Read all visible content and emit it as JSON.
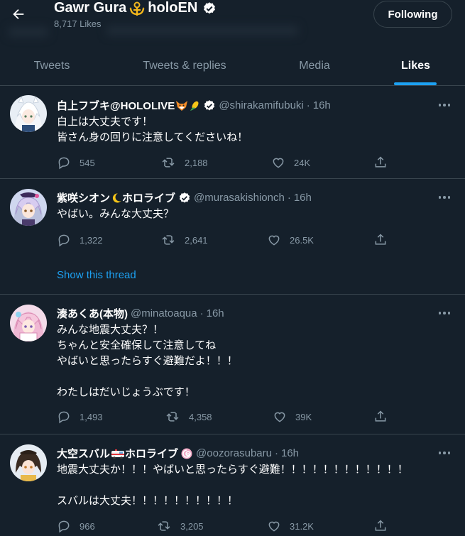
{
  "header": {
    "title": "Gawr Gura",
    "title_suffix": "holoEN",
    "likes_count": "8,717 Likes",
    "follow_label": "Following"
  },
  "tabs": [
    {
      "label": "Tweets",
      "active": false
    },
    {
      "label": "Tweets & replies",
      "active": false
    },
    {
      "label": "Media",
      "active": false
    },
    {
      "label": "Likes",
      "active": true
    }
  ],
  "tweets": [
    {
      "name": "白上フブキ@HOLOLIVE",
      "handle": "@shirakamifubuki",
      "time": "16h",
      "text": "白上は大丈夫です！\n皆さん身の回りに注意してくださいね！",
      "replies": "545",
      "retweets": "2,188",
      "likes": "24K"
    },
    {
      "name": "紫咲シオン",
      "name_suffix": "ホロライブ",
      "handle": "@murasakishionch",
      "time": "16h",
      "text": "やばい。みんな大丈夫？",
      "replies": "1,322",
      "retweets": "2,641",
      "likes": "26.5K",
      "thread_link": "Show this thread"
    },
    {
      "name": "湊あくあ(本物)",
      "handle": "@minatoaqua",
      "time": "16h",
      "text": "みんな地震大丈夫？！\nちゃんと安全確保して注意してね\nやばいと思ったらすぐ避難だよ！！！\n\nわたしはだいじょうぶです！",
      "replies": "1,493",
      "retweets": "4,358",
      "likes": "39K"
    },
    {
      "name": "大空スバル",
      "name_suffix": "ホロライブ",
      "handle": "@oozorasubaru",
      "time": "16h",
      "text": "地震大丈夫か！！！やばいと思ったらすぐ避難！！！！！！！！！！！！\n\nスバルは大丈夫！！！！！！！！！！",
      "replies": "966",
      "retweets": "3,205",
      "likes": "31.2K"
    }
  ],
  "colors": {
    "background": "#15202b",
    "border": "#38444d",
    "secondary_text": "#8899a6",
    "accent": "#1da1f2"
  }
}
